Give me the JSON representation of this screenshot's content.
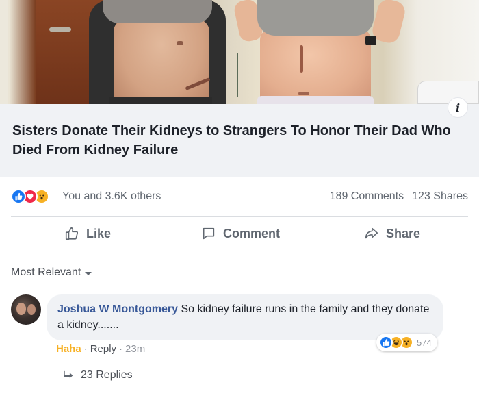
{
  "link_preview": {
    "title": "Sisters Donate Their Kidneys to Strangers To Honor Their Dad Who Died From Kidney Failure",
    "info_glyph": "i"
  },
  "post_stats": {
    "reactions_text": "You and 3.6K others",
    "comments": "189 Comments",
    "shares": "123 Shares"
  },
  "actions": {
    "like": "Like",
    "comment": "Comment",
    "share": "Share"
  },
  "comments_filter": {
    "label": "Most Relevant"
  },
  "comment": {
    "author": "Joshua W Montgomery",
    "text": "So kidney failure runs in the family and they donate a kidney.......",
    "reaction_label": "Haha",
    "reply_label": "Reply",
    "sep1": "·",
    "sep2": "·",
    "time": "23m",
    "reaction_count": "574",
    "replies": "23 Replies"
  },
  "colors": {
    "like_blue": "#1877f2",
    "love_red": "#f0284a",
    "wow_yellow": "#f7b125",
    "author_blue": "#385898"
  }
}
